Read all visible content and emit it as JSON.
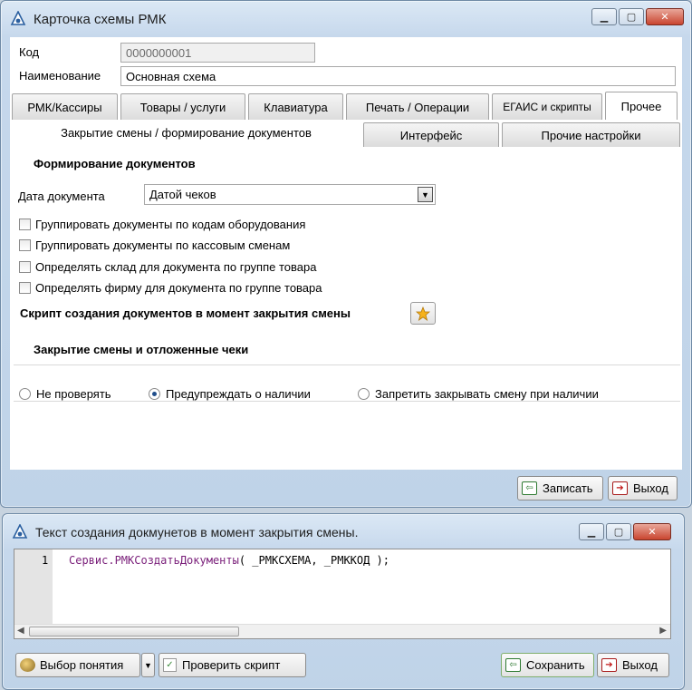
{
  "main_window": {
    "title": "Карточка схемы РМК",
    "code_label": "Код",
    "code_value": "0000000001",
    "name_label": "Наименование",
    "name_value": "Основная схема",
    "tabs": [
      "РМК/Кассиры",
      "Товары / услуги",
      "Клавиатура",
      "Печать / Операции",
      "ЕГАИС и скрипты",
      "Прочее"
    ],
    "subtabs": [
      "Закрытие смены / формирование документов",
      "Интерфейс",
      "Прочие настройки"
    ],
    "doc_section_title": "Формирование документов",
    "date_label": "Дата документа",
    "date_value": "Датой чеков",
    "checks": [
      "Группировать документы по кодам оборудования",
      "Группировать документы по кассовым сменам",
      "Определять склад для документа по группе товара",
      "Определять фирму для  документа по группе товара"
    ],
    "script_label": "Скрипт создания документов в момент закрытия смены",
    "close_section_title": "Закрытие смены и отложенные чеки",
    "radios": [
      "Не проверять",
      "Предупреждать о наличии",
      "Запретить закрывать смену при наличии"
    ],
    "radio_selected": 1,
    "save_label": "Записать",
    "exit_label": "Выход"
  },
  "script_window": {
    "title": "Текст создания докмунетов в момент закрытия смены.",
    "line_number": "1",
    "code_func": "Сервис.РМКСоздатьДокументы",
    "code_args": "( _РМКСХЕМА, _РМККОД );",
    "choose_label": "Выбор понятия",
    "check_label": "Проверить скрипт",
    "save_label": "Сохранить",
    "exit_label": "Выход"
  },
  "colors": {
    "code_func": "#7a1f7a",
    "titlebar": "#c6d8ec"
  }
}
